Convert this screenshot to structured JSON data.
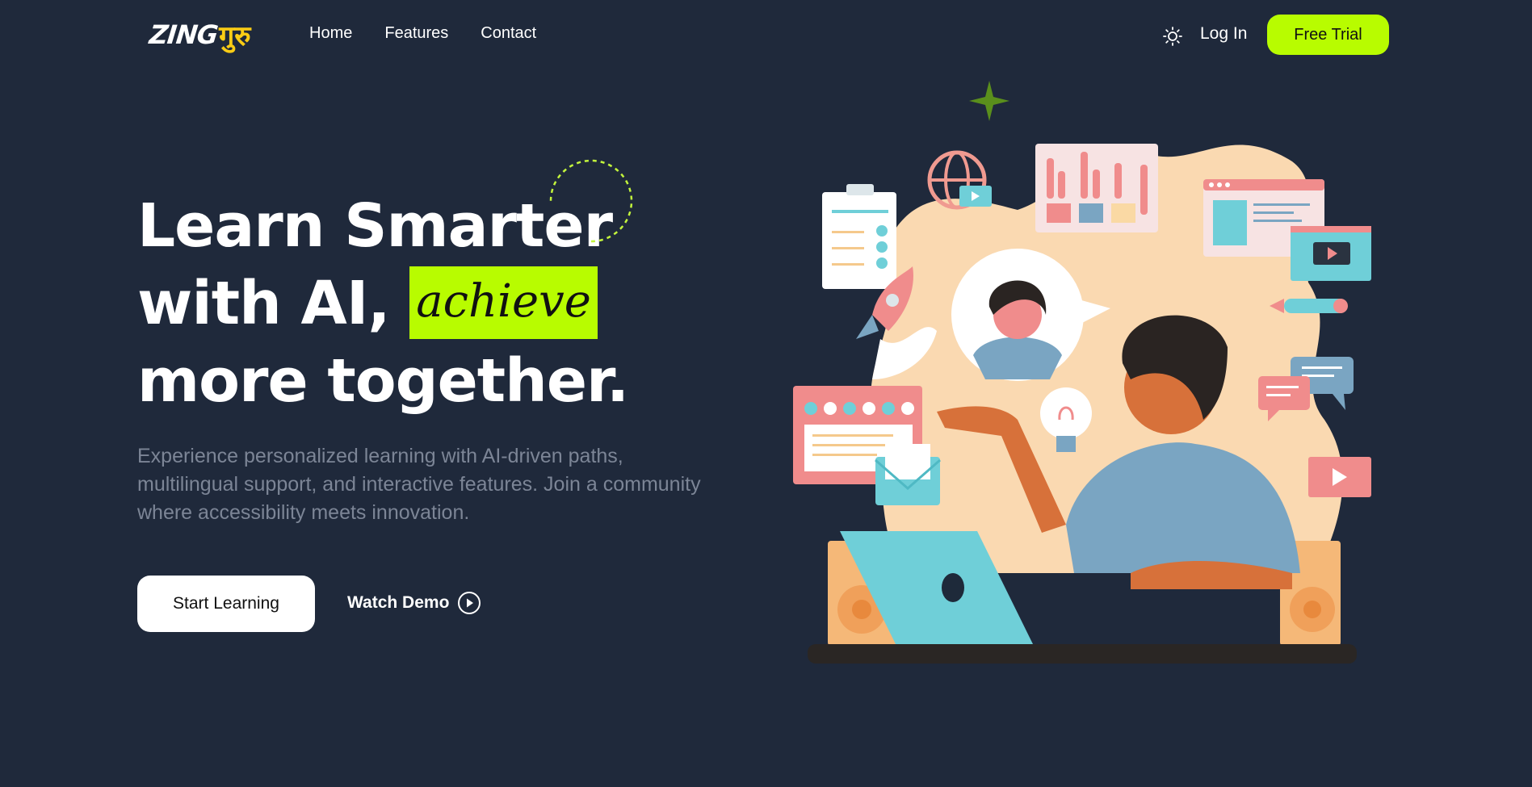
{
  "nav": {
    "logo_latin": "ZING",
    "logo_devanagari": "गुरु",
    "links": [
      {
        "label": "Home"
      },
      {
        "label": "Features"
      },
      {
        "label": "Contact"
      }
    ],
    "theme_icon": "sun-icon",
    "login_label": "Log In",
    "free_trial_label": "Free Trial"
  },
  "hero": {
    "title_line1": "Learn Smarter",
    "title_line2_prefix": "with AI,",
    "title_highlight": "achieve",
    "title_line3": "more together.",
    "subtitle": "Experience personalized learning with AI-driven paths, multilingual support, and interactive features. Join a community where accessibility meets innovation.",
    "start_label": "Start Learning",
    "demo_label": "Watch Demo",
    "demo_icon": "play-circle-icon"
  },
  "colors": {
    "background": "#1f293b",
    "accent": "#b8fc00",
    "logo_accent": "#facc15",
    "muted_text": "#7c8596"
  }
}
